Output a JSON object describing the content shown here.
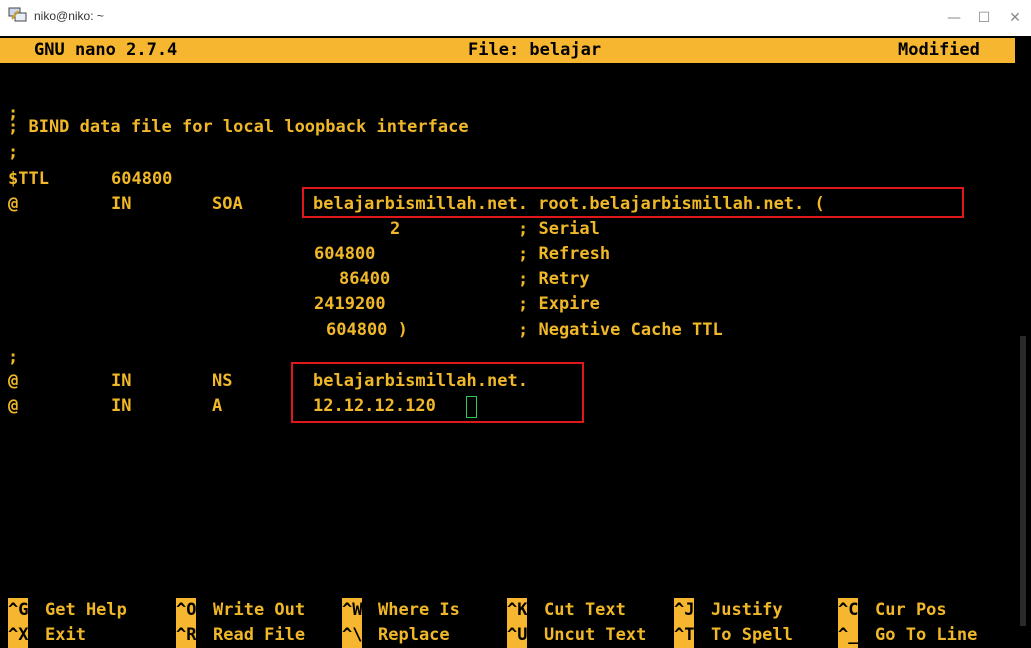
{
  "window": {
    "title": "niko@niko: ~",
    "icon": "putty-icon",
    "controls": {
      "minimize": "—",
      "maximize": "☐",
      "close": "✕"
    }
  },
  "nano": {
    "version": "GNU nano 2.7.4",
    "file": "File: belajar",
    "status": "Modified"
  },
  "lines": [
    "",
    ";",
    "; BIND data file for local loopback interface",
    ";",
    {
      "c1": "$TTL",
      "c2": "604800"
    },
    {
      "c1": "@",
      "c2": "IN",
      "c3": "SOA",
      "c4": "belajarbismillah.net. root.belajarbismillah.net. ("
    },
    {
      "num": "2",
      "comment": "; Serial"
    },
    {
      "num": "604800",
      "comment": "; Refresh"
    },
    {
      "num": "86400",
      "comment": "; Retry"
    },
    {
      "num": "2419200",
      "comment": "; Expire"
    },
    {
      "num": "604800 )",
      "comment": "; Negative Cache TTL"
    },
    ";",
    {
      "c1": "@",
      "c2": "IN",
      "c3": "NS",
      "c4": "belajarbismillah.net."
    },
    {
      "c1": "@",
      "c2": "IN",
      "c3": "A",
      "c4": "12.12.12.120"
    }
  ],
  "shortcuts_row1": [
    {
      "key": "^G",
      "label": "Get Help"
    },
    {
      "key": "^O",
      "label": "Write Out"
    },
    {
      "key": "^W",
      "label": "Where Is"
    },
    {
      "key": "^K",
      "label": "Cut Text"
    },
    {
      "key": "^J",
      "label": "Justify"
    },
    {
      "key": "^C",
      "label": "Cur Pos"
    }
  ],
  "shortcuts_row2": [
    {
      "key": "^X",
      "label": "Exit"
    },
    {
      "key": "^R",
      "label": "Read File"
    },
    {
      "key": "^\\",
      "label": "Replace"
    },
    {
      "key": "^U",
      "label": "Uncut Text"
    },
    {
      "key": "^T",
      "label": "To Spell"
    },
    {
      "key": "^_",
      "label": "Go To Line"
    }
  ],
  "colors": {
    "header_bg": "#f6b62f",
    "text": "#f0b828",
    "highlight_box": "#e0181c",
    "cursor": "#2ec75a"
  }
}
